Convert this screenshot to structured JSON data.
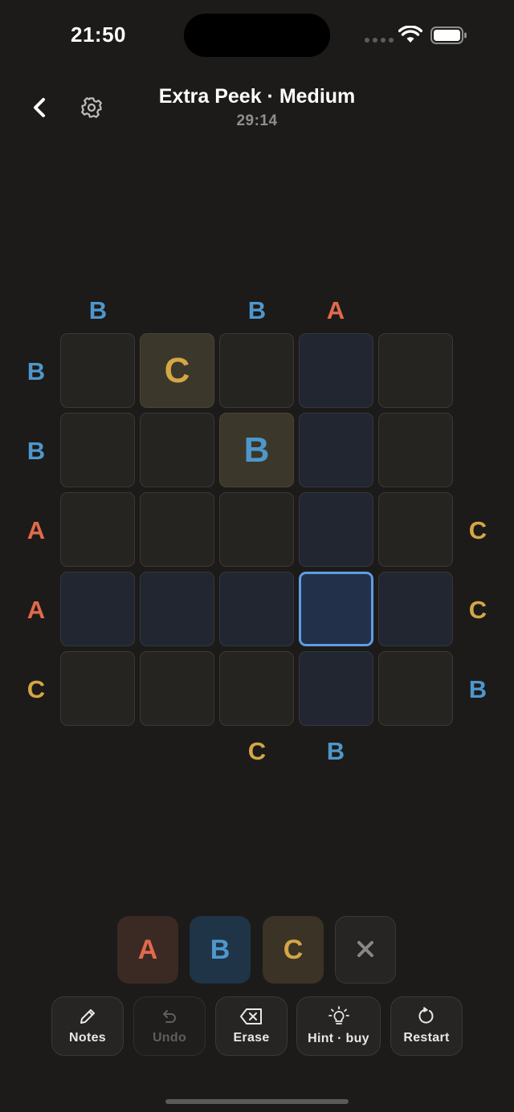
{
  "status": {
    "time": "21:50"
  },
  "header": {
    "title": "Extra Peek · Medium",
    "timer": "29:14"
  },
  "colors": {
    "A": "#e06a4c",
    "B": "#4e97cc",
    "C": "#d4a646",
    "selected_border": "#5e9de6"
  },
  "clues": {
    "top": [
      "B",
      "",
      "B",
      "A",
      ""
    ],
    "left": [
      "B",
      "B",
      "A",
      "A",
      "C"
    ],
    "right": [
      "",
      "",
      "C",
      "C",
      "B"
    ],
    "bottom": [
      "",
      "",
      "C",
      "B",
      ""
    ]
  },
  "grid": {
    "rows": 5,
    "cols": 5,
    "cells": [
      [
        "",
        "C",
        "",
        "",
        ""
      ],
      [
        "",
        "",
        "B",
        "",
        ""
      ],
      [
        "",
        "",
        "",
        "",
        ""
      ],
      [
        "",
        "",
        "",
        "",
        ""
      ],
      [
        "",
        "",
        "",
        "",
        ""
      ]
    ],
    "givens": [
      [
        0,
        1
      ],
      [
        1,
        2
      ]
    ],
    "selected": [
      3,
      3
    ]
  },
  "picker": {
    "a_label": "A",
    "b_label": "B",
    "c_label": "C",
    "clear_icon": "close-icon"
  },
  "toolbar": {
    "notes_label": "Notes",
    "undo_label": "Undo",
    "erase_label": "Erase",
    "hint_label": "Hint · buy",
    "restart_label": "Restart"
  },
  "icons": {
    "back": "chevron-left-icon",
    "settings": "gear-icon",
    "notes": "pencil-icon",
    "undo": "undo-icon",
    "erase": "erase-icon",
    "hint": "lightbulb-icon",
    "restart": "restart-icon"
  }
}
